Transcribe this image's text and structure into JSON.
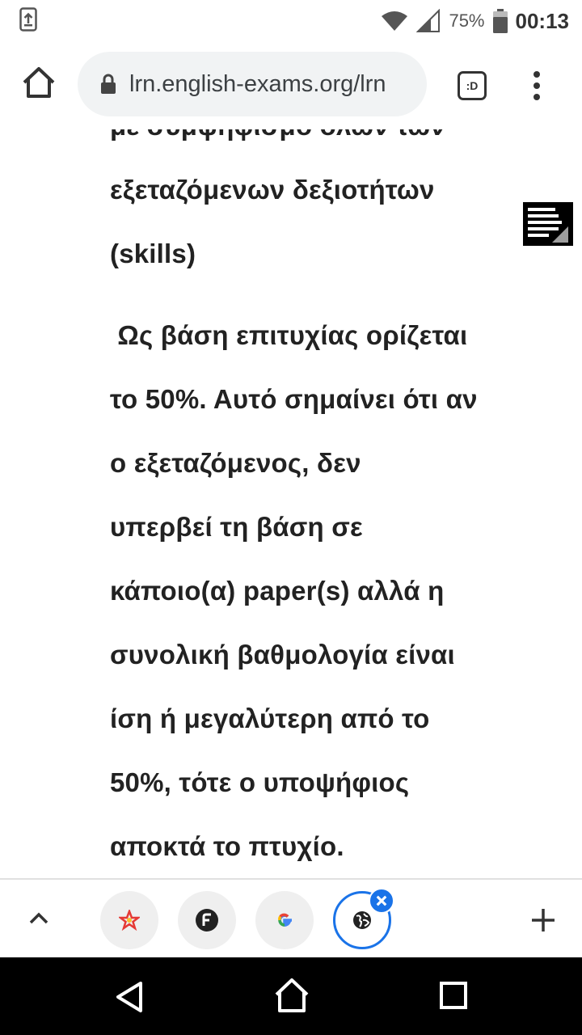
{
  "status_bar": {
    "battery_percent": "75%",
    "time": "00:13",
    "icons": [
      "screenshot-upload-icon",
      "wifi-icon",
      "signal-icon",
      "battery-icon"
    ]
  },
  "browser": {
    "url": "lrn.english-exams.org/lrn",
    "tabs_button_label": ":D",
    "icons": [
      "home-icon",
      "lock-icon",
      "more-vert-icon"
    ]
  },
  "content": {
    "paragraph1": [
      "με συμψηφισμό όλων των",
      "εξεταζόμενων δεξιοτήτων",
      "(skills)"
    ],
    "paragraph2": [
      " Ως βάση επιτυχίας ορίζεται",
      "το 50%. Αυτό σημαίνει ότι αν",
      "ο εξεταζόμενος, δεν",
      "υπερβεί τη βάση σε",
      "κάποιο(α) paper(s) αλλά η",
      "συνολική βαθμολογία είναι",
      "ίση ή μεγαλύτερη από το",
      "50%, τότε ο υποψήφιος",
      "αποκτά το πτυχίο."
    ]
  },
  "bottom_strip": {
    "icons": [
      "chevron-up-icon",
      "star-favicon-icon",
      "f-favicon-icon",
      "google-favicon-icon",
      "globe-favicon-icon",
      "close-icon",
      "plus-icon"
    ]
  },
  "nav_bar": {
    "icons": [
      "back-icon",
      "home-icon",
      "recents-icon"
    ]
  }
}
